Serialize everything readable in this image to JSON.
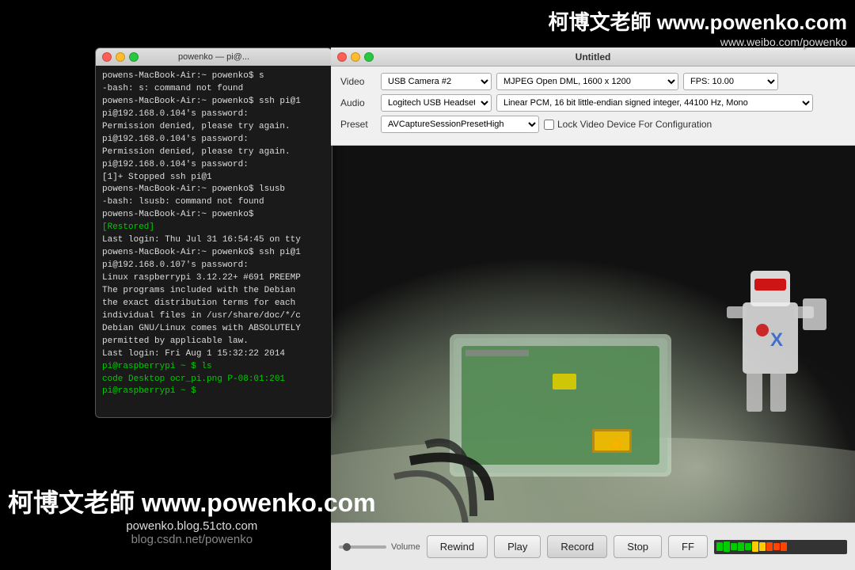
{
  "watermark": {
    "top_line": "柯博文老師 www.powenko.com",
    "sub_line": "www.weibo.com/powenko",
    "bottom_main": "柯博文老師 www.powenko.com",
    "bottom_url1": "powenko.blog.51cto.com",
    "bottom_url2": "blog.csdn.net/powenko"
  },
  "camera_window": {
    "title": "Untitled"
  },
  "terminal": {
    "title": "powenko — pi@...",
    "content_lines": [
      "powens-MacBook-Air:~ powenko$ s",
      "-bash: s: command not found",
      "powens-MacBook-Air:~ powenko$ ssh pi@1",
      "pi@192.168.0.104's password:",
      "Permission denied, please try again.",
      "pi@192.168.0.104's password:",
      "Permission denied, please try again.",
      "pi@192.168.0.104's password:",
      "",
      "[1]+  Stopped                 ssh pi@1",
      "powens-MacBook-Air:~ powenko$ lsusb",
      "-bash: lsusb: command not found",
      "powens-MacBook-Air:~ powenko$",
      "   [Restored]",
      "Last login: Thu Jul 31 16:54:45 on tty",
      "powens-MacBook-Air:~ powenko$ ssh pi@1",
      "pi@192.168.0.107's password:",
      "Linux raspberrypi 3.12.22+ #691 PREEMP",
      "",
      "The programs included with the Debian",
      "the exact distribution terms for each",
      "individual files in /usr/share/doc/*/c",
      "",
      "Debian GNU/Linux comes with ABSOLUTELY",
      "permitted by applicable law.",
      "Last login: Fri Aug  1 15:32:22 2014",
      "pi@raspberrypi ~ $ ls",
      "code  Desktop  ocr_pi.png  P-08:01:201",
      "pi@raspberrypi ~ $ "
    ]
  },
  "controls": {
    "video_label": "Video",
    "audio_label": "Audio",
    "preset_label": "Preset",
    "video_device": "USB Camera #2",
    "video_codec": "MJPEG Open DML, 1600 x 1200",
    "video_fps": "FPS: 10.00",
    "audio_device": "Logitech USB Headset",
    "audio_format": "Linear PCM, 16 bit little-endian signed integer, 44100 Hz, Mono",
    "preset_value": "AVCaptureSessionPresetHigh",
    "lock_checkbox_label": "Lock Video Device For Configuration"
  },
  "playback": {
    "volume_label": "Volume",
    "rewind_label": "Rewind",
    "play_label": "Play",
    "record_label": "Record",
    "stop_label": "Stop",
    "ff_label": "FF"
  },
  "level_bars": [
    {
      "color": "#00cc00",
      "height": "80%"
    },
    {
      "color": "#00cc00",
      "height": "90%"
    },
    {
      "color": "#00cc00",
      "height": "70%"
    },
    {
      "color": "#00cc00",
      "height": "85%"
    },
    {
      "color": "#00cc00",
      "height": "60%"
    },
    {
      "color": "#ffcc00",
      "height": "90%"
    },
    {
      "color": "#ffcc00",
      "height": "75%"
    },
    {
      "color": "#ff4400",
      "height": "85%"
    },
    {
      "color": "#ff4400",
      "height": "70%"
    },
    {
      "color": "#ff4400",
      "height": "80%"
    }
  ]
}
